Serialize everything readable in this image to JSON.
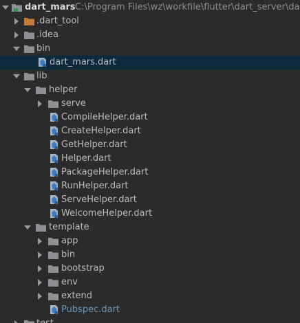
{
  "project": {
    "name": "dart_mars",
    "path": "C:\\Program Files\\wz\\workfile\\flutter\\dart_server\\dart_"
  },
  "tree": {
    "dart_tool": ".dart_tool",
    "idea": ".idea",
    "bin": "bin",
    "bin_file": "dart_mars.dart",
    "lib": "lib",
    "helper": "helper",
    "serve": "serve",
    "helper_files": [
      "CompileHelper.dart",
      "CreateHelper.dart",
      "GetHelper.dart",
      "Helper.dart",
      "PackageHelper.dart",
      "RunHelper.dart",
      "ServeHelper.dart",
      "WelcomeHelper.dart"
    ],
    "template": "template",
    "template_folders": [
      "app",
      "bin",
      "bootstrap",
      "env",
      "extend"
    ],
    "pubspec": "Pubspec.dart",
    "next_partial": "test"
  },
  "colors": {
    "background": "#2b2b2b",
    "selected_row": "#0d293e",
    "folder": "#8d9196",
    "excluded_folder": "#c47a3a",
    "dart_link_blue": "#6897bb"
  }
}
